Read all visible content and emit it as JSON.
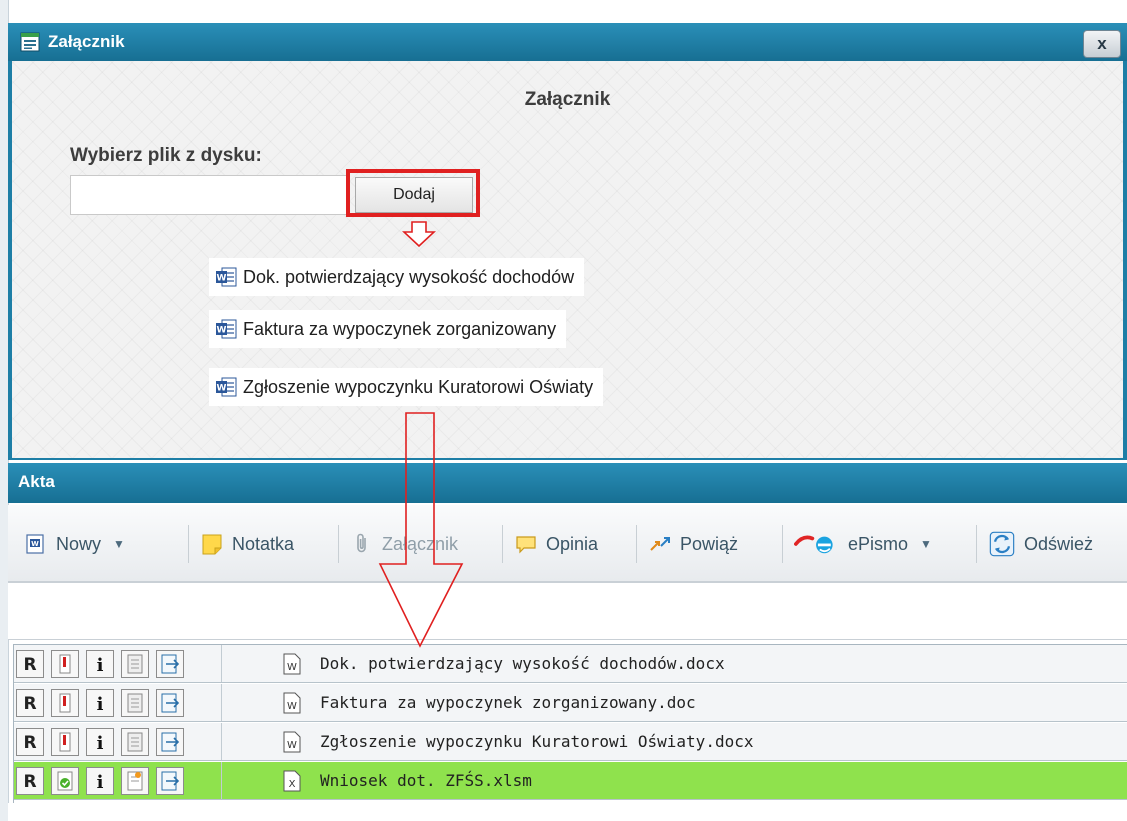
{
  "dialog": {
    "title": "Załącznik",
    "close_label": "x",
    "heading": "Załącznik",
    "choose_label": "Wybierz plik z dysku:",
    "file_input_value": "",
    "add_button_label": "Dodaj",
    "highlight_color": "#e02020",
    "documents": [
      {
        "name": "Dok. potwierdzający wysokość dochodów",
        "icon": "word-doc-icon"
      },
      {
        "name": "Faktura za wypoczynek zorganizowany",
        "icon": "word-doc-icon"
      },
      {
        "name": "Zgłoszenie wypoczynku Kuratorowi Oświaty",
        "icon": "word-doc-icon"
      }
    ]
  },
  "akta": {
    "title": "Akta",
    "toolbar": [
      {
        "label": "Nowy",
        "icon": "new-document-icon",
        "has_dropdown": true
      },
      {
        "label": "Notatka",
        "icon": "sticky-note-icon"
      },
      {
        "label": "Załącznik",
        "icon": "paperclip-icon",
        "disabled": true
      },
      {
        "label": "Opinia",
        "icon": "speech-bubble-icon"
      },
      {
        "label": "Powiąż",
        "icon": "link-arrows-icon"
      },
      {
        "label": "ePismo",
        "icon": "epismo-logo-icon",
        "has_dropdown": true
      },
      {
        "label": "Odśwież",
        "icon": "refresh-icon"
      }
    ],
    "files": [
      {
        "name": "Dok. potwierdzający wysokość dochodów.docx",
        "type": "word",
        "highlighted": false
      },
      {
        "name": "Faktura za wypoczynek zorganizowany.doc",
        "type": "word",
        "highlighted": false
      },
      {
        "name": "Zgłoszenie wypoczynku Kuratorowi Oświaty.docx",
        "type": "word",
        "highlighted": false
      },
      {
        "name": "Wniosek dot. ZFŚS.xlsm",
        "type": "excel",
        "highlighted": true
      }
    ]
  },
  "colors": {
    "titlebar": "#1d7ea6",
    "highlight_row": "#8fe24d",
    "arrow": "#e02020"
  }
}
